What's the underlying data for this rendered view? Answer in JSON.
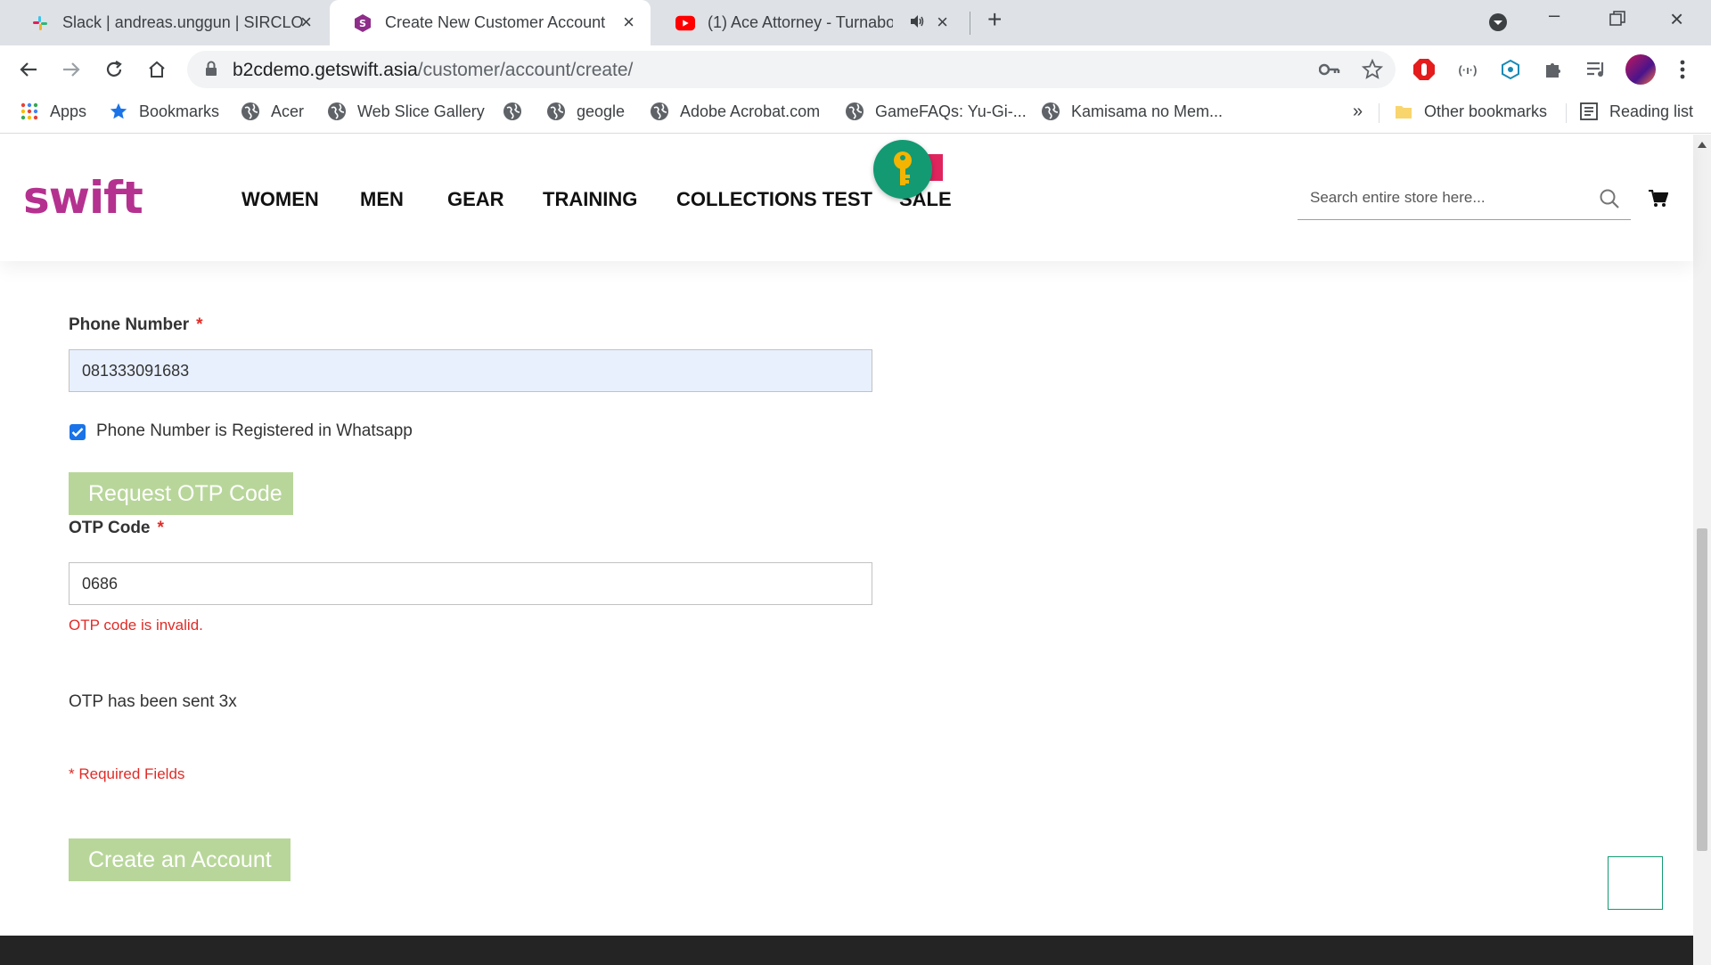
{
  "browser": {
    "tabs": [
      {
        "title": "Slack | andreas.unggun | SIRCLO",
        "active": false
      },
      {
        "title": "Create New Customer Account",
        "active": true
      },
      {
        "title": "(1) Ace Attorney - Turnabout",
        "active": false
      }
    ],
    "address": {
      "host": "b2cdemo.getswift.asia",
      "path": "/customer/account/create/"
    },
    "bookmarks": [
      "Apps",
      "Bookmarks",
      "Acer",
      "Web Slice Gallery",
      "",
      "geogle",
      "Adobe Acrobat.com",
      "GameFAQs: Yu-Gi-...",
      "Kamisama no Mem..."
    ],
    "overflow": "»",
    "other_bookmarks": "Other bookmarks",
    "reading_list": "Reading list"
  },
  "site": {
    "logo": "swift",
    "nav": [
      "WOMEN",
      "MEN",
      "GEAR",
      "TRAINING",
      "COLLECTIONS TEST",
      "SALE"
    ],
    "search_placeholder": "Search entire store here..."
  },
  "form": {
    "password_mask": "•••••••••",
    "phone_label": "Phone Number",
    "phone_value": "081333091683",
    "required_mark": "*",
    "whatsapp_checkbox_label": "Phone Number is Registered in Whatsapp",
    "whatsapp_checked": true,
    "request_otp_button": "Request OTP Code",
    "otp_label": "OTP Code",
    "otp_value": "0686",
    "otp_error": "OTP code is invalid.",
    "otp_sent_message": "OTP has been sent 3x",
    "required_fields_note": "* Required Fields",
    "create_account_button": "Create an Account"
  },
  "colors": {
    "brand": "#b5318f",
    "button": "#b8d69a",
    "error": "#e02b27",
    "autofill": "#e8f0fe",
    "accent_green": "#139a73"
  }
}
